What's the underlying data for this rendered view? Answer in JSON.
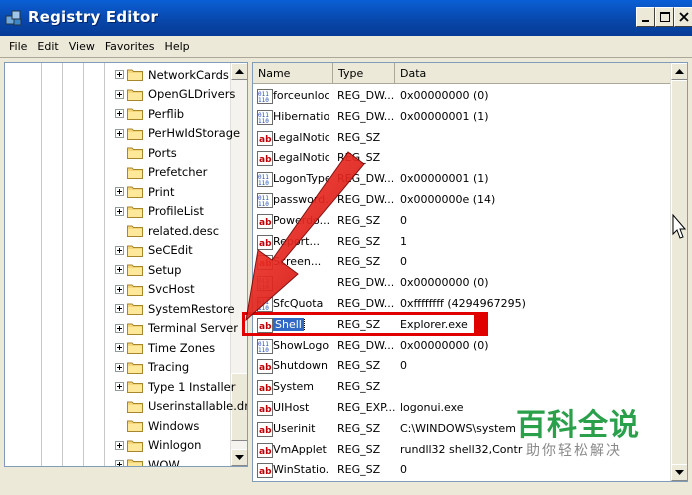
{
  "window": {
    "title": "Registry Editor"
  },
  "menu": [
    "File",
    "Edit",
    "View",
    "Favorites",
    "Help"
  ],
  "tree": [
    {
      "label": "NetworkCards",
      "expandable": true
    },
    {
      "label": "OpenGLDrivers",
      "expandable": true
    },
    {
      "label": "Perflib",
      "expandable": true
    },
    {
      "label": "PerHwIdStorage",
      "expandable": true
    },
    {
      "label": "Ports",
      "expandable": false
    },
    {
      "label": "Prefetcher",
      "expandable": false
    },
    {
      "label": "Print",
      "expandable": true
    },
    {
      "label": "ProfileList",
      "expandable": true
    },
    {
      "label": "related.desc",
      "expandable": false
    },
    {
      "label": "SeCEdit",
      "expandable": true
    },
    {
      "label": "Setup",
      "expandable": true
    },
    {
      "label": "SvcHost",
      "expandable": true
    },
    {
      "label": "SystemRestore",
      "expandable": true
    },
    {
      "label": "Terminal Server",
      "expandable": true
    },
    {
      "label": "Time Zones",
      "expandable": true
    },
    {
      "label": "Tracing",
      "expandable": true
    },
    {
      "label": "Type 1 Installer",
      "expandable": true
    },
    {
      "label": "Userinstallable.driv",
      "expandable": false
    },
    {
      "label": "Windows",
      "expandable": false
    },
    {
      "label": "Winlogon",
      "expandable": true
    },
    {
      "label": "WOW",
      "expandable": true
    }
  ],
  "columns": {
    "name": "Name",
    "type": "Type",
    "data": "Data"
  },
  "values": [
    {
      "name": "forceunloc...",
      "type": "REG_DW...",
      "data": "0x00000000 (0)",
      "kind": "dword"
    },
    {
      "name": "Hibernatio...",
      "type": "REG_DW...",
      "data": "0x00000001 (1)",
      "kind": "dword"
    },
    {
      "name": "LegalNotic...",
      "type": "REG_SZ",
      "data": "",
      "kind": "sz"
    },
    {
      "name": "LegalNotic...",
      "type": "REG_SZ",
      "data": "",
      "kind": "sz"
    },
    {
      "name": "LogonType",
      "type": "REG_DW...",
      "data": "0x00000001 (1)",
      "kind": "dword"
    },
    {
      "name": "password...",
      "type": "REG_DW...",
      "data": "0x0000000e (14)",
      "kind": "dword"
    },
    {
      "name": "Powerdo...",
      "type": "REG_SZ",
      "data": "0",
      "kind": "sz"
    },
    {
      "name": "Report...",
      "type": "REG_SZ",
      "data": "1",
      "kind": "sz"
    },
    {
      "name": "Screen...",
      "type": "REG_SZ",
      "data": "0",
      "kind": "sz"
    },
    {
      "name": "",
      "type": "REG_DW...",
      "data": "0x00000000 (0)",
      "kind": "dword"
    },
    {
      "name": "SfcQuota",
      "type": "REG_DW...",
      "data": "0xffffffff (4294967295)",
      "kind": "dword"
    },
    {
      "name": "Shell",
      "type": "REG_SZ",
      "data": "Explorer.exe",
      "kind": "sz",
      "selected": true
    },
    {
      "name": "ShowLogo...",
      "type": "REG_DW...",
      "data": "0x00000000 (0)",
      "kind": "dword"
    },
    {
      "name": "Shutdown...",
      "type": "REG_SZ",
      "data": "0",
      "kind": "sz"
    },
    {
      "name": "System",
      "type": "REG_SZ",
      "data": "",
      "kind": "sz"
    },
    {
      "name": "UIHost",
      "type": "REG_EXP...",
      "data": "logonui.exe",
      "kind": "sz"
    },
    {
      "name": "Userinit",
      "type": "REG_SZ",
      "data": "C:\\WINDOWS\\system",
      "kind": "sz"
    },
    {
      "name": "VmApplet",
      "type": "REG_SZ",
      "data": "rundll32 shell32,Contr",
      "kind": "sz"
    },
    {
      "name": "WinStatio...",
      "type": "REG_SZ",
      "data": "0",
      "kind": "sz"
    }
  ],
  "watermark": {
    "main": "百科全说",
    "sub": "助你轻松解决"
  },
  "colors": {
    "title_bar": "#0846a8",
    "selection": "#316ac5",
    "highlight_box": "#e00000",
    "arrow": "#e00000",
    "watermark": "#2aa04a"
  }
}
